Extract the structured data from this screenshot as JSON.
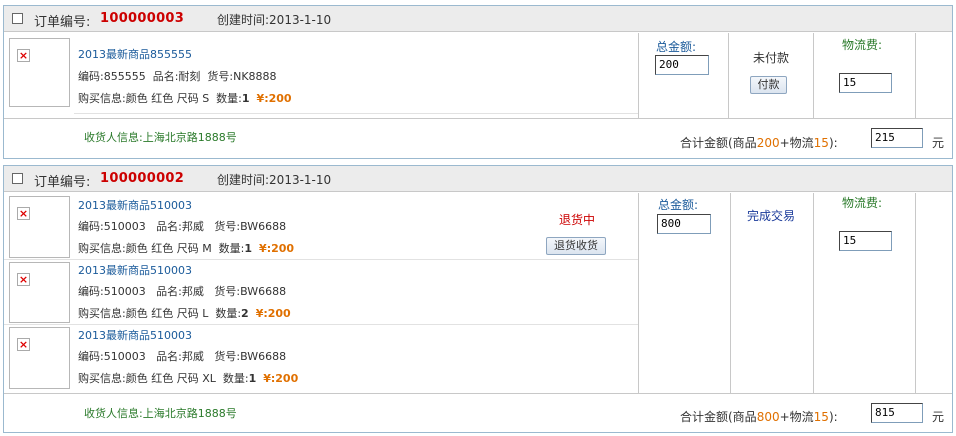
{
  "orders": [
    {
      "order_label": "订单编号:",
      "order_id": "100000003",
      "created": "创建时间:2013-1-10",
      "products": [
        {
          "name": "2013最新商品855555",
          "code_line": "编码:855555  品名:耐刻  货号:NK8888",
          "buy_line": "购买信息:颜色 红色 尺码 S  数量:",
          "qty": "1",
          "price": "¥:200"
        }
      ],
      "total_label": "总金额:",
      "total_value": "200",
      "status": "未付款",
      "action_button": "付款",
      "shipping_label": "物流费:",
      "shipping_value": "15",
      "receiver": "收货人信息:上海北京路1888号",
      "sum_prefix": "合计金额(商品",
      "sum_goods": "200",
      "sum_mid": "+物流",
      "sum_ship": "15",
      "sum_suffix": "):",
      "sum_value": "215",
      "currency": "元"
    },
    {
      "order_label": "订单编号:",
      "order_id": "100000002",
      "created": "创建时间:2013-1-10",
      "products": [
        {
          "name": "2013最新商品510003",
          "code_line": "编码:510003   品名:邦威   货号:BW6688",
          "buy_line": "购买信息:颜色 红色 尺码 M  数量:",
          "qty": "1",
          "price": "¥:200"
        },
        {
          "name": "2013最新商品510003",
          "code_line": "编码:510003   品名:邦威   货号:BW6688",
          "buy_line": "购买信息:颜色 红色 尺码 L  数量:",
          "qty": "2",
          "price": "¥:200"
        },
        {
          "name": "2013最新商品510003",
          "code_line": "编码:510003   品名:邦威   货号:BW6688",
          "buy_line": "购买信息:颜色 红色 尺码 XL  数量:",
          "qty": "1",
          "price": "¥:200"
        }
      ],
      "return_status": "退货中",
      "return_button": "退货收货",
      "total_label": "总金额:",
      "total_value": "800",
      "status": "完成交易",
      "shipping_label": "物流费:",
      "shipping_value": "15",
      "receiver": "收货人信息:上海北京路1888号",
      "sum_prefix": "合计金额(商品",
      "sum_goods": "800",
      "sum_mid": "+物流",
      "sum_ship": "15",
      "sum_suffix": "):",
      "sum_value": "815",
      "currency": "元"
    }
  ]
}
